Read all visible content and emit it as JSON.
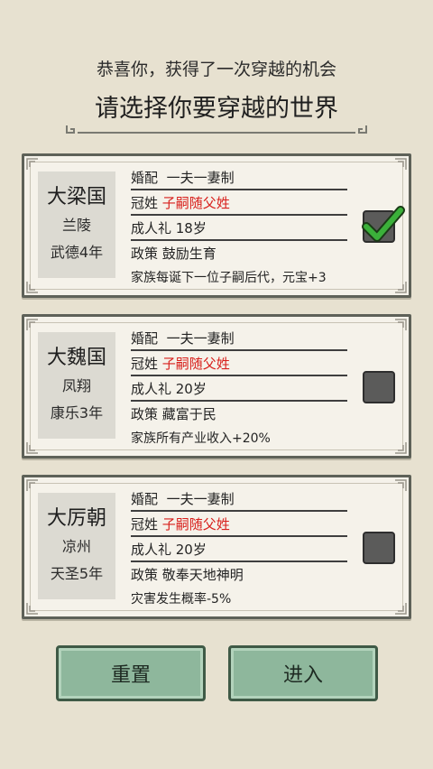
{
  "header": {
    "subtitle": "恭喜你，获得了一次穿越的机会",
    "title": "请选择你要穿越的世界"
  },
  "worlds": [
    {
      "name": "大梁国",
      "place": "兰陵",
      "era": "武德4年",
      "marriage_label": "婚配",
      "marriage_value": "一夫一妻制",
      "surname_label": "冠姓",
      "surname_value": "子嗣随父姓",
      "coming_of_age": "成人礼 18岁",
      "policy": "政策 鼓励生育",
      "policy_effect": "家族每诞下一位子嗣后代，元宝+3",
      "selected": true
    },
    {
      "name": "大魏国",
      "place": "凤翔",
      "era": "康乐3年",
      "marriage_label": "婚配",
      "marriage_value": "一夫一妻制",
      "surname_label": "冠姓",
      "surname_value": "子嗣随父姓",
      "coming_of_age": "成人礼 20岁",
      "policy": "政策 藏富于民",
      "policy_effect": "家族所有产业收入+20%",
      "selected": false
    },
    {
      "name": "大厉朝",
      "place": "凉州",
      "era": "天圣5年",
      "marriage_label": "婚配",
      "marriage_value": "一夫一妻制",
      "surname_label": "冠姓",
      "surname_value": "子嗣随父姓",
      "coming_of_age": "成人礼 20岁",
      "policy": "政策 敬奉天地神明",
      "policy_effect": "灾害发生概率-5%",
      "selected": false
    }
  ],
  "buttons": {
    "reset": "重置",
    "enter": "进入"
  },
  "colors": {
    "background": "#e7e1d0",
    "highlight_red": "#d8201c",
    "button_green": "#8eb79c",
    "check_green": "#3bb03a"
  }
}
